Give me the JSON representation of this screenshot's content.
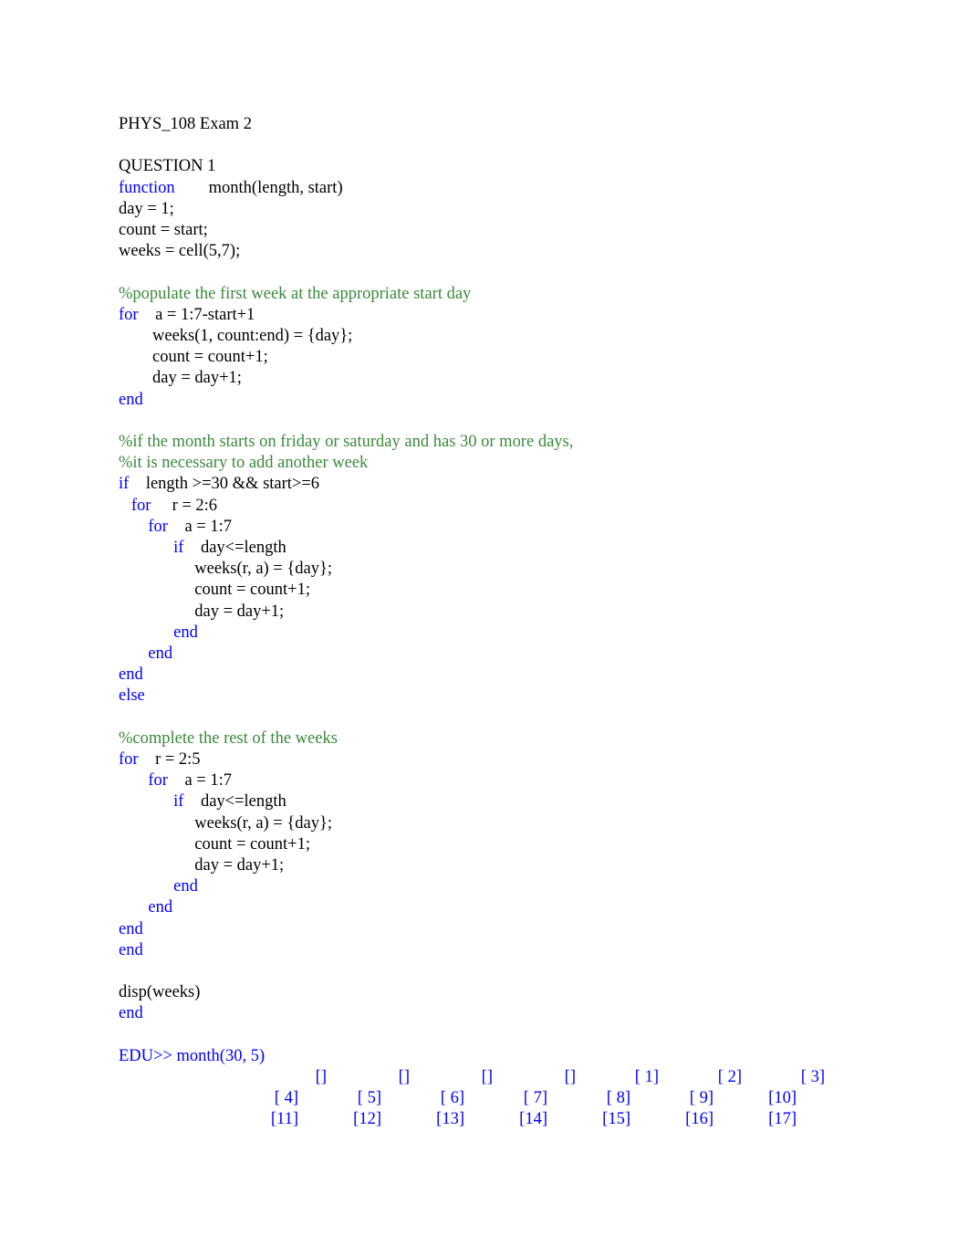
{
  "document": {
    "title": "PHYS_108 Exam 2",
    "question_heading": "QUESTION 1"
  },
  "code": {
    "lines": [
      {
        "indent": 0,
        "segments": [
          {
            "text": "function",
            "style": "keyword"
          },
          {
            "text": "        month(length, start)",
            "style": "plain"
          }
        ]
      },
      {
        "indent": 0,
        "segments": [
          {
            "text": "day = 1;",
            "style": "plain"
          }
        ]
      },
      {
        "indent": 0,
        "segments": [
          {
            "text": "count = start;",
            "style": "plain"
          }
        ]
      },
      {
        "indent": 0,
        "segments": [
          {
            "text": "weeks = cell(5,7);",
            "style": "plain"
          }
        ]
      },
      {
        "indent": 0,
        "segments": [
          {
            "text": "",
            "style": "plain"
          }
        ]
      },
      {
        "indent": 0,
        "segments": [
          {
            "text": "%populate the first week at the appropriate start day",
            "style": "comment"
          }
        ]
      },
      {
        "indent": 0,
        "segments": [
          {
            "text": "for",
            "style": "keyword"
          },
          {
            "text": "    a = 1:7-start+1",
            "style": "plain"
          }
        ]
      },
      {
        "indent": 0,
        "segments": [
          {
            "text": "        weeks(1, count:end) = {day};",
            "style": "plain"
          }
        ]
      },
      {
        "indent": 0,
        "segments": [
          {
            "text": "        count = count+1;",
            "style": "plain"
          }
        ]
      },
      {
        "indent": 0,
        "segments": [
          {
            "text": "        day = day+1;",
            "style": "plain"
          }
        ]
      },
      {
        "indent": 0,
        "segments": [
          {
            "text": "end",
            "style": "keyword"
          }
        ]
      },
      {
        "indent": 0,
        "segments": [
          {
            "text": "",
            "style": "plain"
          }
        ]
      },
      {
        "indent": 0,
        "segments": [
          {
            "text": "%if the month starts on friday or saturday and has 30 or more days,",
            "style": "comment"
          }
        ]
      },
      {
        "indent": 0,
        "segments": [
          {
            "text": "%it is necessary to add another week",
            "style": "comment"
          }
        ]
      },
      {
        "indent": 0,
        "segments": [
          {
            "text": "if",
            "style": "keyword"
          },
          {
            "text": "    length >=30 && start>=6",
            "style": "plain"
          }
        ]
      },
      {
        "indent": 0,
        "segments": [
          {
            "text": "   for",
            "style": "keyword"
          },
          {
            "text": "     r = 2:6",
            "style": "plain"
          }
        ]
      },
      {
        "indent": 0,
        "segments": [
          {
            "text": "       for",
            "style": "keyword"
          },
          {
            "text": "    a = 1:7",
            "style": "plain"
          }
        ]
      },
      {
        "indent": 0,
        "segments": [
          {
            "text": "             if",
            "style": "keyword"
          },
          {
            "text": "    day<=length",
            "style": "plain"
          }
        ]
      },
      {
        "indent": 0,
        "segments": [
          {
            "text": "                  weeks(r, a) = {day};",
            "style": "plain"
          }
        ]
      },
      {
        "indent": 0,
        "segments": [
          {
            "text": "                  count = count+1;",
            "style": "plain"
          }
        ]
      },
      {
        "indent": 0,
        "segments": [
          {
            "text": "                  day = day+1;",
            "style": "plain"
          }
        ]
      },
      {
        "indent": 0,
        "segments": [
          {
            "text": "             end",
            "style": "keyword"
          }
        ]
      },
      {
        "indent": 0,
        "segments": [
          {
            "text": "       end",
            "style": "keyword"
          }
        ]
      },
      {
        "indent": 0,
        "segments": [
          {
            "text": "end",
            "style": "keyword"
          }
        ]
      },
      {
        "indent": 0,
        "segments": [
          {
            "text": "else",
            "style": "keyword"
          }
        ]
      },
      {
        "indent": 0,
        "segments": [
          {
            "text": "",
            "style": "plain"
          }
        ]
      },
      {
        "indent": 0,
        "segments": [
          {
            "text": "%complete the rest of the weeks",
            "style": "comment"
          }
        ]
      },
      {
        "indent": 0,
        "segments": [
          {
            "text": "for",
            "style": "keyword"
          },
          {
            "text": "    r = 2:5",
            "style": "plain"
          }
        ]
      },
      {
        "indent": 0,
        "segments": [
          {
            "text": "       for",
            "style": "keyword"
          },
          {
            "text": "    a = 1:7",
            "style": "plain"
          }
        ]
      },
      {
        "indent": 0,
        "segments": [
          {
            "text": "             if",
            "style": "keyword"
          },
          {
            "text": "    day<=length",
            "style": "plain"
          }
        ]
      },
      {
        "indent": 0,
        "segments": [
          {
            "text": "                  weeks(r, a) = {day};",
            "style": "plain"
          }
        ]
      },
      {
        "indent": 0,
        "segments": [
          {
            "text": "                  count = count+1;",
            "style": "plain"
          }
        ]
      },
      {
        "indent": 0,
        "segments": [
          {
            "text": "                  day = day+1;",
            "style": "plain"
          }
        ]
      },
      {
        "indent": 0,
        "segments": [
          {
            "text": "             end",
            "style": "keyword"
          }
        ]
      },
      {
        "indent": 0,
        "segments": [
          {
            "text": "       end",
            "style": "keyword"
          }
        ]
      },
      {
        "indent": 0,
        "segments": [
          {
            "text": "end",
            "style": "keyword"
          }
        ]
      },
      {
        "indent": 0,
        "segments": [
          {
            "text": "end",
            "style": "keyword"
          }
        ]
      },
      {
        "indent": 0,
        "segments": [
          {
            "text": "",
            "style": "plain"
          }
        ]
      },
      {
        "indent": 0,
        "segments": [
          {
            "text": "disp(weeks)",
            "style": "plain"
          }
        ]
      },
      {
        "indent": 0,
        "segments": [
          {
            "text": "end",
            "style": "keyword"
          }
        ]
      }
    ]
  },
  "console": {
    "prompt": "EDU>> month(30, 5)",
    "rows": [
      [
        "[]",
        "[]",
        "[]",
        "[]",
        "[ 1]",
        "[ 2]",
        "[ 3]"
      ],
      [
        "[ 4]",
        "[ 5]",
        "[ 6]",
        "[ 7]",
        "[ 8]",
        "[ 9]",
        "[10]"
      ],
      [
        "[11]",
        "[12]",
        "[13]",
        "[14]",
        "[15]",
        "[16]",
        "[17]"
      ]
    ]
  },
  "colors": {
    "keyword": "#0000ff",
    "comment": "#3a8a3a",
    "text": "#000000",
    "output": "#0000ff",
    "background": "#ffffff"
  }
}
